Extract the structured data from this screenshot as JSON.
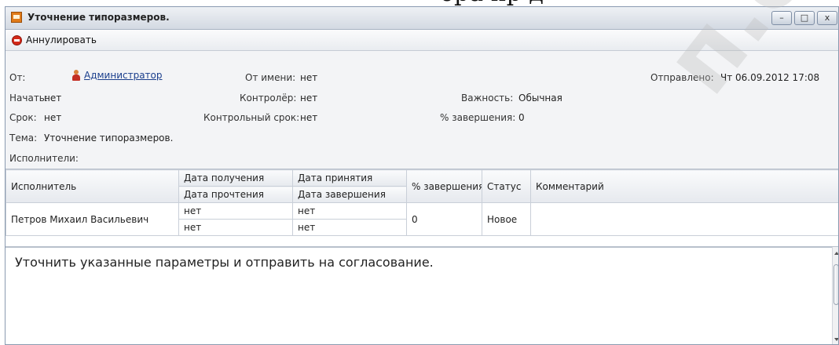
{
  "page_caption": "ора пр  д",
  "window": {
    "title": "Уточнение типоразмеров.",
    "buttons": {
      "minimize": "–",
      "maximize": "□",
      "close": "x"
    }
  },
  "toolbar": {
    "cancel_label": "Аннулировать"
  },
  "info": {
    "from_label": "От:",
    "from_value": "Администратор",
    "on_behalf_label": "От имени:",
    "on_behalf_value": "нет",
    "sent_label": "Отправлено:",
    "sent_value": "Чт 06.09.2012 17:08",
    "start_label": "Начать:",
    "start_value": "нет",
    "controller_label": "Контролёр:",
    "controller_value": "нет",
    "importance_label": "Важность:",
    "importance_value": "Обычная",
    "deadline_label": "Срок:",
    "deadline_value": "нет",
    "control_deadline_label": "Контрольный срок:",
    "control_deadline_value": "нет",
    "completion_label": "% завершения:",
    "completion_value": "0",
    "subject_label": "Тема:",
    "subject_value": "Уточнение типоразмеров.",
    "executors_label": "Исполнители:"
  },
  "table": {
    "headers": {
      "executor": "Исполнитель",
      "received": "Дата получения",
      "accepted": "Дата принятия",
      "read": "Дата прочтения",
      "completed": "Дата завершения",
      "percent": "% завершения",
      "status": "Статус",
      "comment": "Комментарий"
    },
    "rows": [
      {
        "executor": "Петров Михаил Васильевич",
        "received": "нет",
        "accepted": "нет",
        "read": "нет",
        "completed": "нет",
        "percent": "0",
        "status": "Новое",
        "comment": ""
      }
    ]
  },
  "message": {
    "text": "Уточнить указанные параметры и отправить на согласование."
  },
  "watermark": {
    "text": "п.о.су"
  }
}
